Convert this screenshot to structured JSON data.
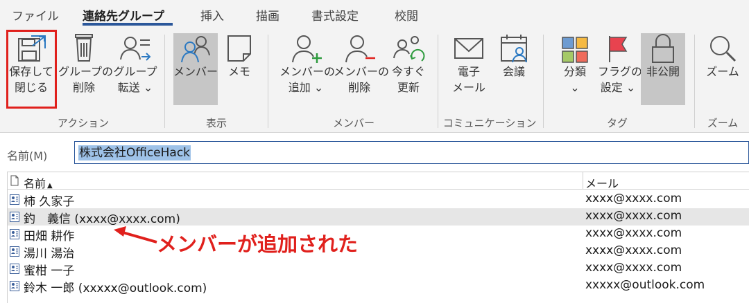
{
  "tabs": [
    {
      "label": "ファイル"
    },
    {
      "label": "連絡先グループ"
    },
    {
      "label": "挿入"
    },
    {
      "label": "描画"
    },
    {
      "label": "書式設定"
    },
    {
      "label": "校閲"
    }
  ],
  "ribbon": {
    "action": {
      "save_close": {
        "line1": "保存して",
        "line2": "閉じる"
      },
      "delete_group": {
        "line1": "グループの",
        "line2": "削除"
      },
      "forward_group": {
        "line1": "グループ",
        "line2": "転送 ⌄"
      },
      "group_label": "アクション"
    },
    "show": {
      "members": {
        "line1": "メンバー"
      },
      "memo": {
        "line1": "メモ"
      },
      "group_label": "表示"
    },
    "members": {
      "add": {
        "line1": "メンバーの",
        "line2": "追加 ⌄"
      },
      "remove": {
        "line1": "メンバーの",
        "line2": "削除"
      },
      "update": {
        "line1": "今すぐ",
        "line2": "更新"
      },
      "group_label": "メンバー"
    },
    "communication": {
      "email": {
        "line1": "電子",
        "line2": "メール"
      },
      "meeting": {
        "line1": "会議"
      },
      "group_label": "コミュニケーション"
    },
    "tags": {
      "categorize": {
        "line1": "分類",
        "line2": "⌄"
      },
      "flag": {
        "line1": "フラグの",
        "line2": "設定 ⌄"
      },
      "private": {
        "line1": "非公開"
      },
      "group_label": "タグ"
    },
    "zoom": {
      "zoom": {
        "line1": "ズーム"
      },
      "group_label": "ズーム"
    }
  },
  "namebar": {
    "label": "名前(M)",
    "value": "株式会社OfficeHack"
  },
  "list": {
    "headers": {
      "name": "名前",
      "sort_indicator": "▲",
      "mail": "メール"
    },
    "rows": [
      {
        "name": "柿 久家子",
        "mail": "xxxx@xxxx.com"
      },
      {
        "name": "釣　義信 (xxxx@xxxx.com)",
        "mail": "xxxx@xxxx.com"
      },
      {
        "name": "田畑 耕作",
        "mail": "xxxx@xxxx.com"
      },
      {
        "name": "湯川 湯治",
        "mail": "xxxx@xxxx.com"
      },
      {
        "name": "蜜柑 一子",
        "mail": "xxxx@xxxx.com"
      },
      {
        "name": "鈴木 一郎 (xxxxx@outlook.com)",
        "mail": "xxxxx@outlook.com"
      }
    ]
  },
  "annotation": {
    "text": "メンバーが追加された"
  },
  "colors": {
    "accent": "#2b579a",
    "annotation_red": "#e0201c",
    "category_tiles": [
      "#6d9bd1",
      "#f5b942",
      "#a5c967",
      "#ef6b5b"
    ],
    "flag": "#e8434f",
    "add": "#2e9b3e",
    "remove": "#e0201c"
  }
}
